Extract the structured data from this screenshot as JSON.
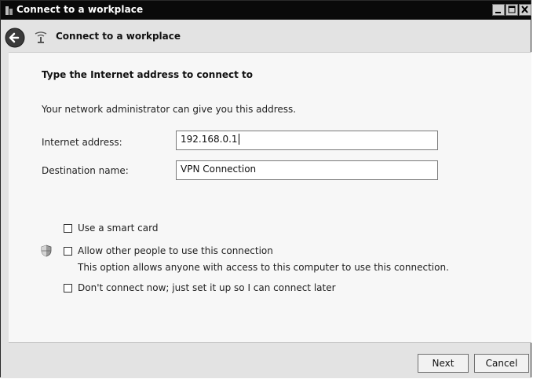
{
  "window": {
    "title": "Connect to a workplace",
    "controls": [
      "minimize-icon",
      "maximize-icon",
      "close-icon"
    ]
  },
  "nav": {
    "title": "Connect to a workplace",
    "back_icon": "back-arrow-icon",
    "page_icon": "network-icon"
  },
  "content": {
    "heading": "Type the Internet address to connect to",
    "subtext": "Your network administrator can give you this address.",
    "internet_address": {
      "label": "Internet address:",
      "value": "192.168.0.1"
    },
    "destination_name": {
      "label": "Destination name:",
      "value": "VPN Connection"
    },
    "options": {
      "smart_card": {
        "label": "Use a smart card",
        "checked": false
      },
      "allow_others": {
        "label": "Allow other people to use this connection",
        "description": "This option allows anyone with access to this computer to use this connection.",
        "checked": false,
        "icon": "shield-icon"
      },
      "connect_later": {
        "label": "Don't connect now; just set it up so I can connect later",
        "checked": false
      }
    }
  },
  "footer": {
    "next_label": "Next",
    "cancel_label": "Cancel"
  }
}
